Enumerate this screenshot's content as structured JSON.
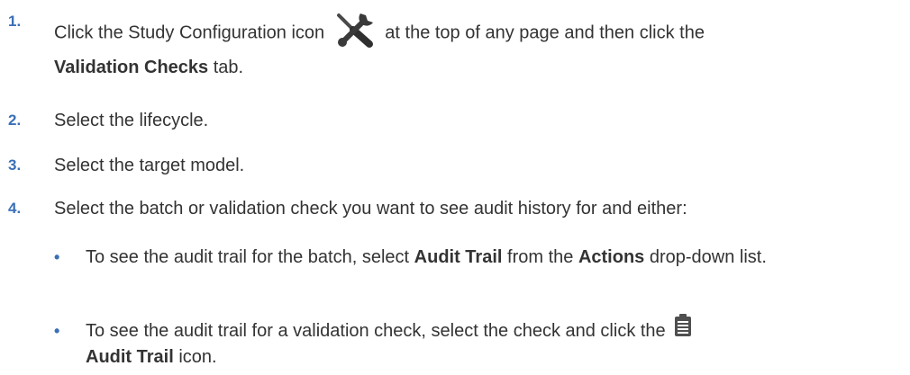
{
  "steps": [
    {
      "number": "1.",
      "pre": "Click the Study Configuration icon",
      "icon": "wrench-screwdriver-icon",
      "mid": "at the top of any page and then click the",
      "bold": "Validation Checks",
      "post": "tab."
    },
    {
      "number": "2.",
      "text": "Select the lifecycle."
    },
    {
      "number": "3.",
      "text": "Select the target model."
    },
    {
      "number": "4.",
      "text": "Select the batch or validation check you want to see audit history for and either:",
      "bullets": [
        {
          "marker": "•",
          "pre": "To see the audit trail for the batch, select",
          "bold1": "Audit Trail",
          "mid": "from the",
          "bold2": "Actions",
          "post": "drop-down list."
        },
        {
          "marker": "•",
          "pre": "To see the audit trail for a validation check, select the check and click the",
          "icon": "audit-trail-icon",
          "bold": "Audit Trail",
          "post": "icon."
        }
      ]
    }
  ]
}
